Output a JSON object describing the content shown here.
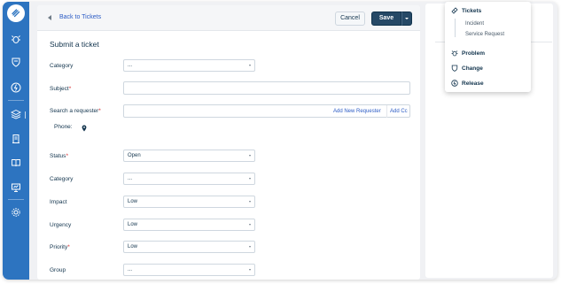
{
  "nav": {
    "icons": [
      "logo-icon",
      "bug-icon",
      "shield-icon",
      "bolt-icon",
      "layers-icon",
      "document-icon",
      "book-icon",
      "presentation-icon",
      "gear-icon"
    ]
  },
  "topbar": {
    "back_label": "Back to Tickets",
    "cancel_label": "Cancel",
    "save_label": "Save"
  },
  "form": {
    "title": "Submit a ticket",
    "category_label": "Category",
    "category_value": "...",
    "subject_label": "Subject",
    "requester_label": "Search a requester",
    "add_requester_label": "Add New Requester",
    "add_cc_label": "Add Cc",
    "phone_label": "Phone:",
    "status_label": "Status",
    "status_value": "Open",
    "category2_label": "Category",
    "category2_value": "...",
    "impact_label": "Impact",
    "impact_value": "Low",
    "urgency_label": "Urgency",
    "urgency_value": "Low",
    "priority_label": "Priority",
    "priority_value": "Low",
    "group_label": "Group",
    "group_value": "...",
    "required_mark": "*"
  },
  "dropdown": {
    "tickets_label": "Tickets",
    "incident_label": "Incident",
    "service_request_label": "Service Request",
    "problem_label": "Problem",
    "change_label": "Change",
    "release_label": "Release"
  },
  "colors": {
    "sidebar": "#2d74c0",
    "primary_button": "#264966",
    "link": "#2c5cc5",
    "required": "#d72d30"
  }
}
